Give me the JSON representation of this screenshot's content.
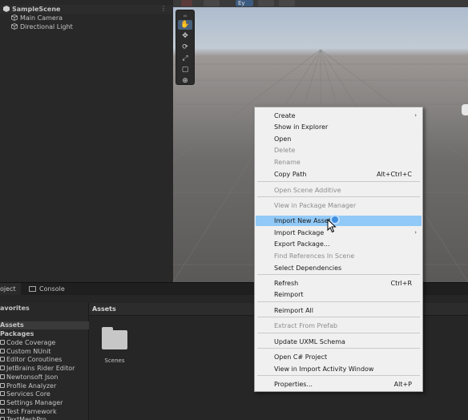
{
  "hierarchy": {
    "scene_name": "SampleScene",
    "items": [
      "Main Camera",
      "Directional Light"
    ]
  },
  "scene_toolbar": {
    "view_dropdown": "Ey"
  },
  "tabs": {
    "project": "oject",
    "console": "Console"
  },
  "project_tree": {
    "favorites": "avorites",
    "assets": "Assets",
    "packages": "Packages",
    "packages_items": [
      "Code Coverage",
      "Custom NUnit",
      "Editor Coroutines",
      "JetBrains Rider Editor",
      "Newtonsoft Json",
      "Profile Analyzer",
      "Services Core",
      "Settings Manager",
      "Test Framework",
      "TextMeshPro"
    ]
  },
  "project_main": {
    "header": "Assets",
    "folders": [
      "Scenes"
    ]
  },
  "context_menu": {
    "items": [
      {
        "label": "Create",
        "submenu": true
      },
      {
        "label": "Show in Explorer"
      },
      {
        "label": "Open"
      },
      {
        "label": "Delete",
        "disabled": true
      },
      {
        "label": "Rename",
        "disabled": true
      },
      {
        "label": "Copy Path",
        "shortcut": "Alt+Ctrl+C"
      },
      {
        "label": "Open Scene Additive",
        "disabled": true
      },
      {
        "label": "View in Package Manager",
        "disabled": true
      },
      {
        "label": "Import New Asset...",
        "highlighted": true
      },
      {
        "label": "Import Package",
        "submenu": true
      },
      {
        "label": "Export Package..."
      },
      {
        "label": "Find References In Scene",
        "disabled": true
      },
      {
        "label": "Select Dependencies"
      },
      {
        "label": "Refresh",
        "shortcut": "Ctrl+R"
      },
      {
        "label": "Reimport"
      },
      {
        "label": "Reimport All"
      },
      {
        "label": "Extract From Prefab",
        "disabled": true
      },
      {
        "label": "Update UXML Schema"
      },
      {
        "label": "Open C# Project"
      },
      {
        "label": "View in Import Activity Window"
      },
      {
        "label": "Properties...",
        "shortcut": "Alt+P"
      }
    ]
  },
  "colors": {
    "menu_highlight": "#91c9f7",
    "tool_active": "#46607c",
    "cursor_ring": "#3f8fe0"
  }
}
